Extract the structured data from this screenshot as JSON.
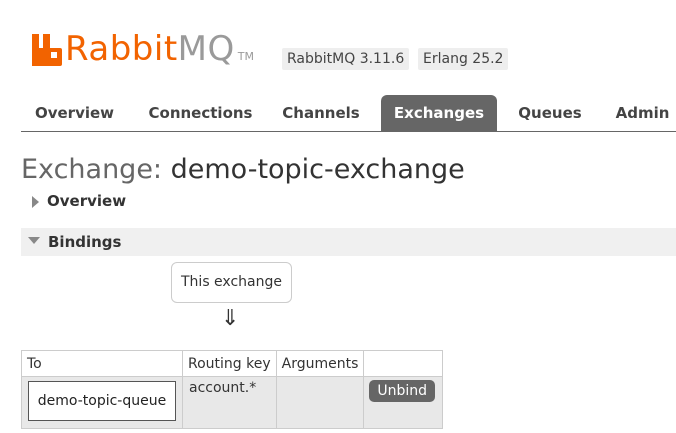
{
  "header": {
    "logo_rabbit": "RabbitMQ",
    "logo_rabbit_part": "Rabbit",
    "logo_mq_part": "MQ",
    "logo_tm": "TM",
    "version": "RabbitMQ 3.11.6",
    "erlang": "Erlang 25.2",
    "brand_color": "#f26300"
  },
  "nav": {
    "tabs": [
      {
        "label": "Overview",
        "active": false
      },
      {
        "label": "Connections",
        "active": false
      },
      {
        "label": "Channels",
        "active": false
      },
      {
        "label": "Exchanges",
        "active": true
      },
      {
        "label": "Queues",
        "active": false
      },
      {
        "label": "Admin",
        "active": false
      }
    ]
  },
  "page": {
    "title_label": "Exchange:",
    "title_name": "demo-topic-exchange"
  },
  "sections": {
    "overview": {
      "label": "Overview",
      "expanded": false
    },
    "bindings": {
      "label": "Bindings",
      "expanded": true
    }
  },
  "bindings": {
    "this_exchange": "This exchange",
    "arrow": "⇓",
    "columns": [
      "To",
      "Routing key",
      "Arguments",
      ""
    ],
    "rows": [
      {
        "to": "demo-topic-queue",
        "routing_key": "account.*",
        "arguments": "",
        "action": "Unbind"
      }
    ]
  }
}
